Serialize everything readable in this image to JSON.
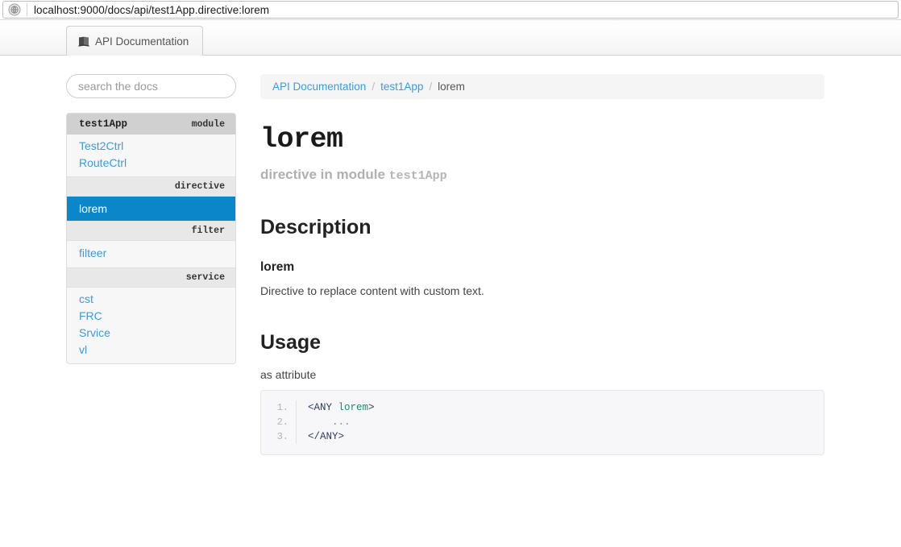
{
  "browser": {
    "url": "localhost:9000/docs/api/test1App.directive:lorem",
    "favicon_icon": "globe-icon",
    "tab": {
      "label": "API Documentation",
      "icon": "book-icon"
    }
  },
  "sidebar": {
    "search": {
      "placeholder": "search the docs",
      "value": ""
    },
    "module": {
      "name": "test1App",
      "type_label": "module"
    },
    "groups": [
      {
        "label": "",
        "items": [
          {
            "label": "Test2Ctrl",
            "active": false
          },
          {
            "label": "RouteCtrl",
            "active": false
          }
        ]
      },
      {
        "label": "directive",
        "items": [
          {
            "label": "lorem",
            "active": true
          }
        ]
      },
      {
        "label": "filter",
        "items": [
          {
            "label": "filteer",
            "active": false
          }
        ]
      },
      {
        "label": "service",
        "items": [
          {
            "label": "cst",
            "active": false
          },
          {
            "label": "FRC",
            "active": false
          },
          {
            "label": "Srvice",
            "active": false
          },
          {
            "label": "vl",
            "active": false
          }
        ]
      }
    ]
  },
  "breadcrumb": {
    "items": [
      {
        "label": "API Documentation",
        "link": true
      },
      {
        "label": "test1App",
        "link": true
      },
      {
        "label": "lorem",
        "link": false
      }
    ],
    "separator": "/"
  },
  "main": {
    "title": "lorem",
    "subtitle_prefix": "directive in module",
    "subtitle_module": "test1App",
    "description": {
      "heading": "Description",
      "sub_heading": "lorem",
      "text": "Directive to replace content with custom text."
    },
    "usage": {
      "heading": "Usage",
      "note": "as attribute",
      "code": {
        "line_numbers": [
          "1.",
          "2.",
          "3."
        ],
        "lines": [
          {
            "tag_open": "<ANY ",
            "attr": "lorem",
            "tag_close": ">"
          },
          {
            "dots": "    ..."
          },
          {
            "tag_full": "</ANY>"
          }
        ]
      }
    }
  },
  "colors": {
    "accent_blue": "#0b86c8",
    "link_blue": "#3d9cd4",
    "code_tag": "#2f3f5b",
    "code_attr": "#1d8a6e",
    "sidebar_head": "#d0d0d0",
    "group_head": "#e8e8e8"
  }
}
